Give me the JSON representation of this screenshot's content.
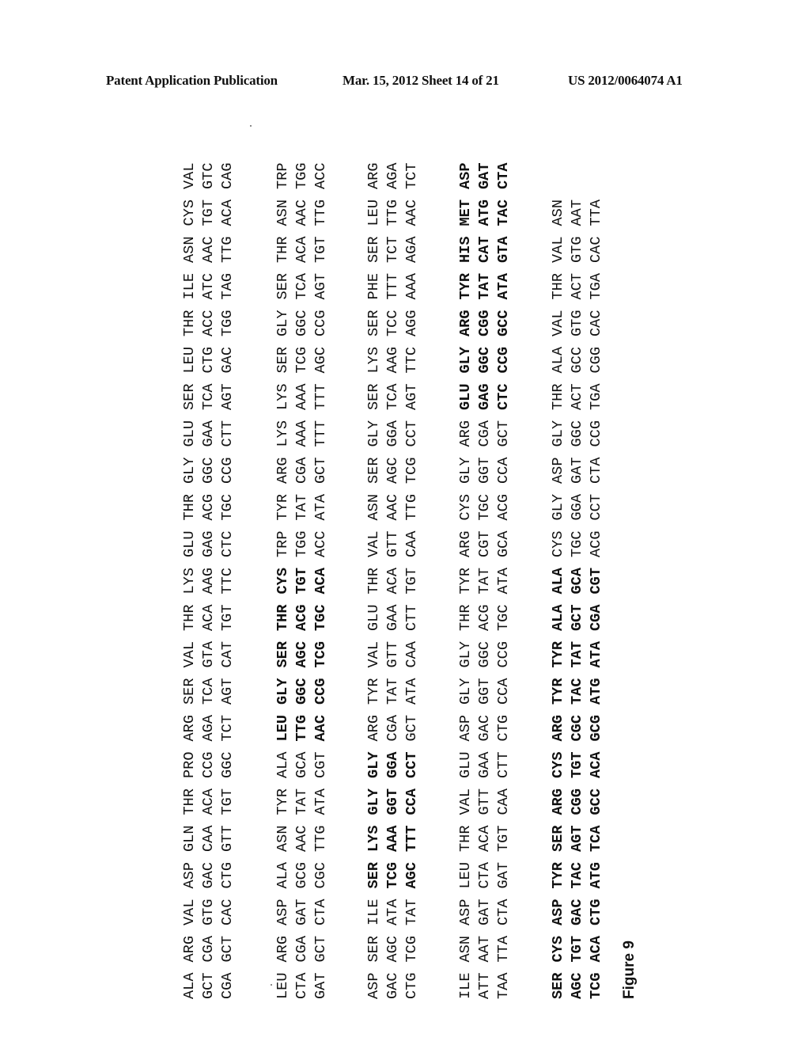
{
  "header": {
    "left": "Patent Application Publication",
    "middle": "Mar. 15, 2012  Sheet 14 of 21",
    "right": "US 2012/0064074 A1"
  },
  "figure": {
    "label": "Figure 9",
    "blocks": [
      {
        "lines": [
          {
            "codons": [
              "ALA",
              "ARG",
              "VAL",
              "ASP",
              "GLN",
              "THR",
              "PRO",
              "ARG",
              "SER",
              "VAL",
              "THR",
              "LYS",
              "GLU",
              "THR",
              "GLY",
              "GLU",
              "SER",
              "LEU",
              "THR",
              "ILE",
              "ASN",
              "CYS",
              "VAL"
            ]
          },
          {
            "codons": [
              "GCT",
              "CGA",
              "GTG",
              "GAC",
              "CAA",
              "ACA",
              "CCG",
              "AGA",
              "TCA",
              "GTA",
              "ACA",
              "AAG",
              "GAG",
              "ACG",
              "GGC",
              "GAA",
              "TCA",
              "CTG",
              "ACC",
              "ATC",
              "AAC",
              "TGT",
              "GTC"
            ]
          },
          {
            "codons": [
              "CGA",
              "GCT",
              "CAC",
              "CTG",
              "GTT",
              "TGT",
              "GGC",
              "TCT",
              "AGT",
              "CAT",
              "TGT",
              "TTC",
              "CTC",
              "TGC",
              "CCG",
              "CTT",
              "AGT",
              "GAC",
              "TGG",
              "TAG",
              "TTG",
              "ACA",
              "CAG"
            ]
          }
        ],
        "bold_range": []
      },
      {
        "lines": [
          {
            "codons": [
              "LEU",
              "ARG",
              "ASP",
              "ALA",
              "ASN",
              "TYR",
              "ALA",
              "LEU",
              "GLY",
              "SER",
              "THR",
              "CYS",
              "TRP",
              "TYR",
              "ARG",
              "LYS",
              "LYS",
              "SER",
              "GLY",
              "SER",
              "THR",
              "ASN",
              "TRP"
            ]
          },
          {
            "codons": [
              "CTA",
              "CGA",
              "GAT",
              "GCG",
              "AAC",
              "TAT",
              "GCA",
              "TTG",
              "GGC",
              "AGC",
              "ACG",
              "TGT",
              "TGG",
              "TAT",
              "CGA",
              "AAA",
              "AAA",
              "TCG",
              "GGC",
              "TCA",
              "ACA",
              "AAC",
              "TGG"
            ]
          },
          {
            "codons": [
              "GAT",
              "GCT",
              "CTA",
              "CGC",
              "TTG",
              "ATA",
              "CGT",
              "AAC",
              "CCG",
              "TCG",
              "TGC",
              "ACA",
              "ACC",
              "ATA",
              "GCT",
              "TTT",
              "TTT",
              "AGC",
              "CCG",
              "AGT",
              "TGT",
              "TTG",
              "ACC"
            ]
          }
        ],
        "bold_range": [
          7,
          11
        ]
      },
      {
        "lines": [
          {
            "codons": [
              "ASP",
              "SER",
              "ILE",
              "SER",
              "LYS",
              "GLY",
              "GLY",
              "ARG",
              "TYR",
              "VAL",
              "GLU",
              "THR",
              "VAL",
              "ASN",
              "SER",
              "GLY",
              "SER",
              "LYS",
              "SER",
              "PHE",
              "SER",
              "LEU",
              "ARG"
            ]
          },
          {
            "codons": [
              "GAC",
              "AGC",
              "ATA",
              "TCG",
              "AAA",
              "GGT",
              "GGA",
              "CGA",
              "TAT",
              "GTT",
              "GAA",
              "ACA",
              "GTT",
              "AAC",
              "AGC",
              "GGA",
              "TCA",
              "AAG",
              "TCC",
              "TTT",
              "TCT",
              "TTG",
              "AGA"
            ]
          },
          {
            "codons": [
              "CTG",
              "TCG",
              "TAT",
              "AGC",
              "TTT",
              "CCA",
              "CCT",
              "GCT",
              "ATA",
              "CAA",
              "CTT",
              "TGT",
              "CAA",
              "TTG",
              "TCG",
              "CCT",
              "AGT",
              "TTC",
              "AGG",
              "AAA",
              "AGA",
              "AAC",
              "TCT"
            ]
          }
        ],
        "bold_range": [
          3,
          6
        ]
      },
      {
        "lines": [
          {
            "codons": [
              "ILE",
              "ASN",
              "ASP",
              "LEU",
              "THR",
              "VAL",
              "GLU",
              "ASP",
              "GLY",
              "GLY",
              "THR",
              "TYR",
              "ARG",
              "CYS",
              "GLY",
              "ARG",
              "GLU",
              "GLY",
              "ARG",
              "TYR",
              "HIS",
              "MET",
              "ASP"
            ]
          },
          {
            "codons": [
              "ATT",
              "AAT",
              "GAT",
              "CTA",
              "ACA",
              "GTT",
              "GAA",
              "GAC",
              "GGT",
              "GGC",
              "ACG",
              "TAT",
              "CGT",
              "TGC",
              "GGT",
              "CGA",
              "GAG",
              "GGC",
              "CGG",
              "TAT",
              "CAT",
              "ATG",
              "GAT"
            ]
          },
          {
            "codons": [
              "TAA",
              "TTA",
              "CTA",
              "GAT",
              "TGT",
              "CAA",
              "CTT",
              "CTG",
              "CCA",
              "CCG",
              "TGC",
              "ATA",
              "GCA",
              "ACG",
              "CCA",
              "GCT",
              "CTC",
              "CCG",
              "GCC",
              "ATA",
              "GTA",
              "TAC",
              "CTA"
            ]
          }
        ],
        "bold_range": [
          16,
          22
        ]
      },
      {
        "lines": [
          {
            "codons": [
              "SER",
              "CYS",
              "ASP",
              "TYR",
              "SER",
              "ARG",
              "CYS",
              "ARG",
              "TYR",
              "TYR",
              "ALA",
              "ALA",
              "CYS",
              "GLY",
              "ASP",
              "GLY",
              "THR",
              "ALA",
              "VAL",
              "THR",
              "VAL",
              "ASN"
            ]
          },
          {
            "codons": [
              "AGC",
              "TGT",
              "GAC",
              "TAC",
              "AGT",
              "CGG",
              "TGT",
              "CGC",
              "TAC",
              "TAT",
              "GCT",
              "GCA",
              "TGC",
              "GGA",
              "GAT",
              "GGC",
              "ACT",
              "GCC",
              "GTG",
              "ACT",
              "GTG",
              "AAT"
            ]
          },
          {
            "codons": [
              "TCG",
              "ACA",
              "CTG",
              "ATG",
              "TCA",
              "GCC",
              "ACA",
              "GCG",
              "ATG",
              "ATA",
              "CGA",
              "CGT",
              "ACG",
              "CCT",
              "CTA",
              "CCG",
              "TGA",
              "CGG",
              "CAC",
              "TGA",
              "CAC",
              "TTA"
            ]
          }
        ],
        "bold_range": [
          0,
          11
        ]
      }
    ]
  }
}
